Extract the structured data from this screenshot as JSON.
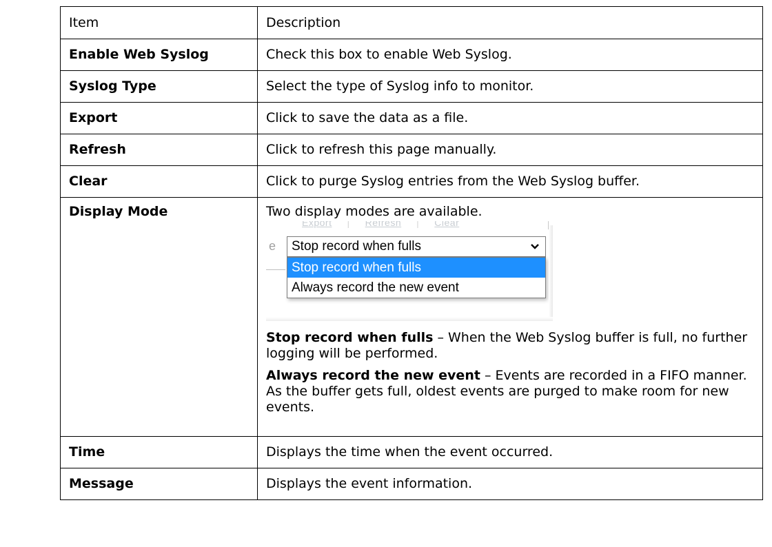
{
  "table": {
    "header": {
      "item": "Item",
      "description": "Description"
    },
    "rows": [
      {
        "item": "Enable Web Syslog",
        "description": "Check this box to enable Web Syslog."
      },
      {
        "item": "Syslog Type",
        "description": "Select the type of Syslog info to monitor."
      },
      {
        "item": "Export",
        "description": "Click to save the data as a file."
      },
      {
        "item": "Refresh",
        "description": "Click to refresh this page manually."
      },
      {
        "item": "Clear",
        "description": "Click to purge Syslog entries from the Web Syslog buffer."
      },
      {
        "item": "Display Mode",
        "description": "Two display modes are available.",
        "screenshot": {
          "faded_links": [
            "Export",
            "Refresh",
            "Clear"
          ],
          "faded_letter": "e",
          "selected_value": "Stop record when fulls",
          "options": [
            "Stop record when fulls",
            "Always record the new event"
          ],
          "highlight_color": "#1e90ff"
        },
        "detail1_term": "Stop record when fulls",
        "detail1_text": " – When the Web Syslog buffer is full, no further logging will be performed.",
        "detail2_term": "Always record the new event",
        "detail2_text": " – Events are recorded in a FIFO manner. As the buffer gets full, oldest events are purged to make room for new events."
      },
      {
        "item": "Time",
        "description": "Displays the time when the event occurred."
      },
      {
        "item": "Message",
        "description": "Displays the event information."
      }
    ]
  }
}
